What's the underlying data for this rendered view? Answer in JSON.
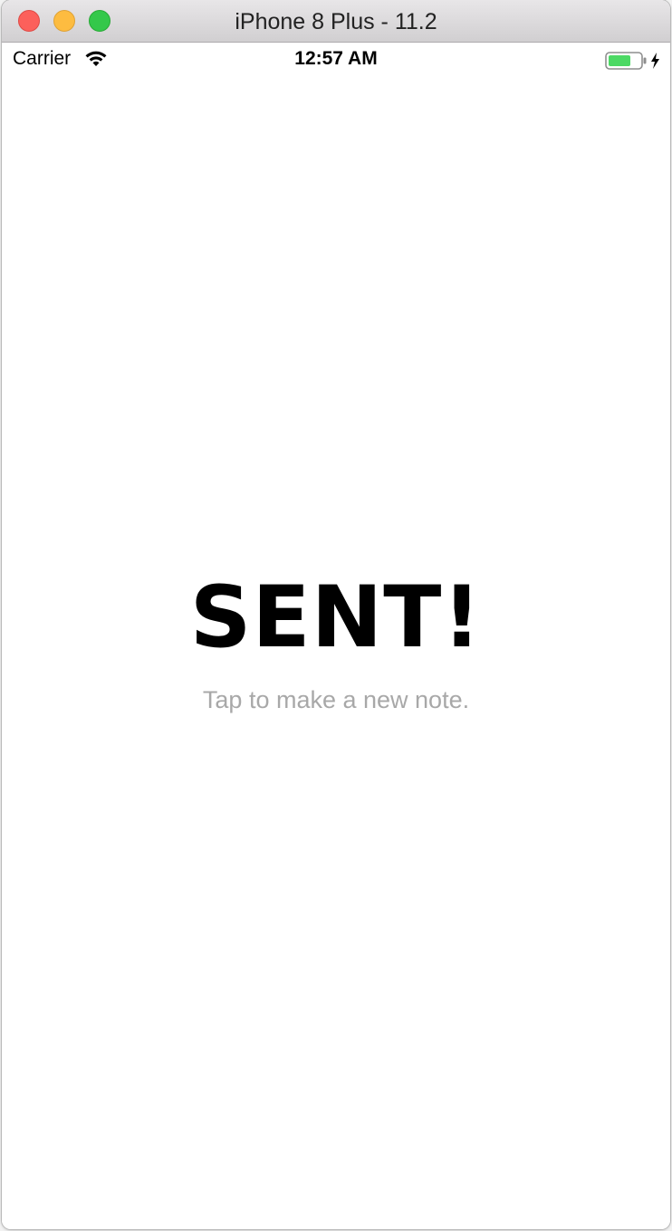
{
  "window": {
    "title": "iPhone 8 Plus - 11.2"
  },
  "status_bar": {
    "carrier": "Carrier",
    "time": "12:57 AM",
    "battery_color": "#4cd964",
    "charging": true
  },
  "screen": {
    "headline": "SENT!",
    "subtitle": "Tap to make a new note."
  },
  "colors": {
    "close": "#fc605b",
    "minimize": "#fdbc40",
    "maximize": "#34c84a",
    "subtitle": "#a8a8a8"
  },
  "icons": [
    "close-icon",
    "minimize-icon",
    "maximize-icon",
    "wifi-icon",
    "battery-icon",
    "charging-bolt-icon"
  ]
}
